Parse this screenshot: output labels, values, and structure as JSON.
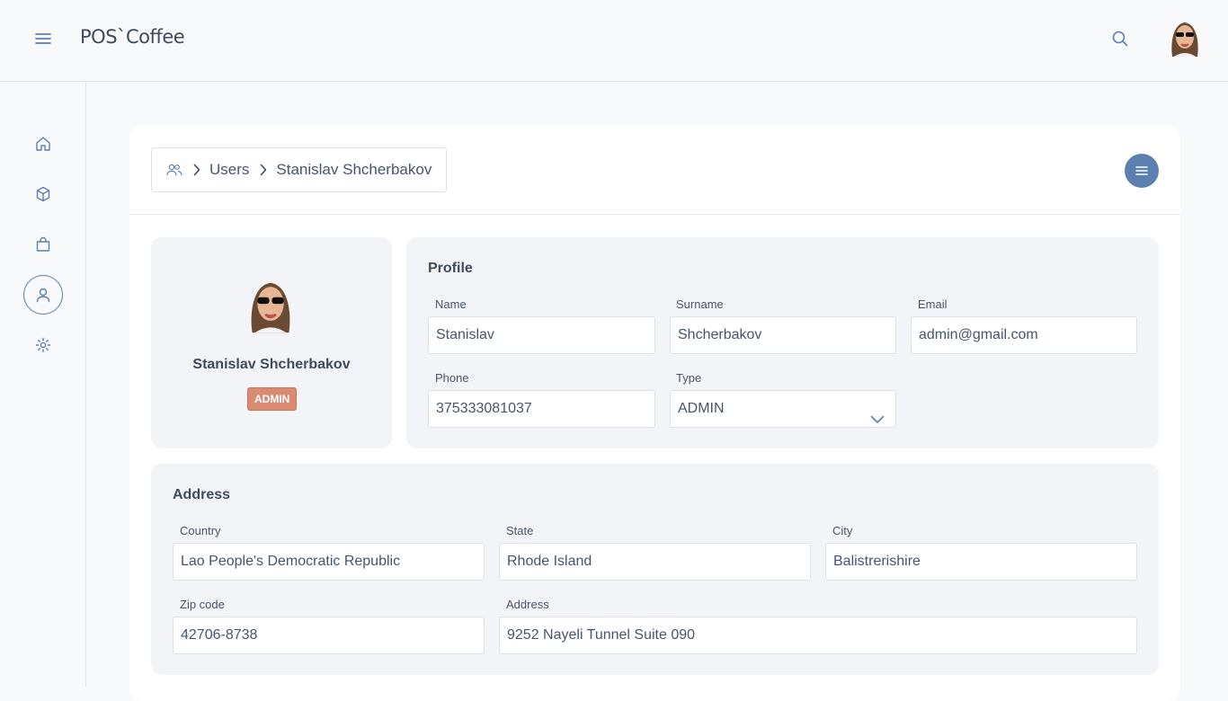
{
  "app": {
    "brand": "POS`Coffee"
  },
  "header": {
    "menu_icon": "hamburger-icon",
    "search_icon": "search-icon"
  },
  "sidebar": {
    "items": [
      {
        "icon": "home-icon"
      },
      {
        "icon": "box-icon"
      },
      {
        "icon": "shopping-bag-icon"
      },
      {
        "icon": "user-icon",
        "active": true
      },
      {
        "icon": "gear-icon"
      }
    ]
  },
  "breadcrumb": {
    "section": "Users",
    "current": "Stanislav Shcherbakov"
  },
  "profile_card": {
    "name": "Stanislav Shcherbakov",
    "role": "ADMIN"
  },
  "profile": {
    "title": "Profile",
    "name_label": "Name",
    "name_value": "Stanislav",
    "surname_label": "Surname",
    "surname_value": "Shcherbakov",
    "email_label": "Email",
    "email_value": "admin@gmail.com",
    "phone_label": "Phone",
    "phone_value": "375333081037",
    "type_label": "Type",
    "type_value": "ADMIN"
  },
  "address": {
    "title": "Address",
    "country_label": "Country",
    "country_value": "Lao People's Democratic Republic",
    "state_label": "State",
    "state_value": "Rhode Island",
    "city_label": "City",
    "city_value": "Balistrerishire",
    "zip_label": "Zip code",
    "zip_value": "42706-8738",
    "address_label": "Address",
    "address_value": "9252 Nayeli Tunnel Suite 090"
  },
  "colors": {
    "accent": "#5b7fae",
    "badge": "#d98a70",
    "panel": "#f3f4f7"
  }
}
